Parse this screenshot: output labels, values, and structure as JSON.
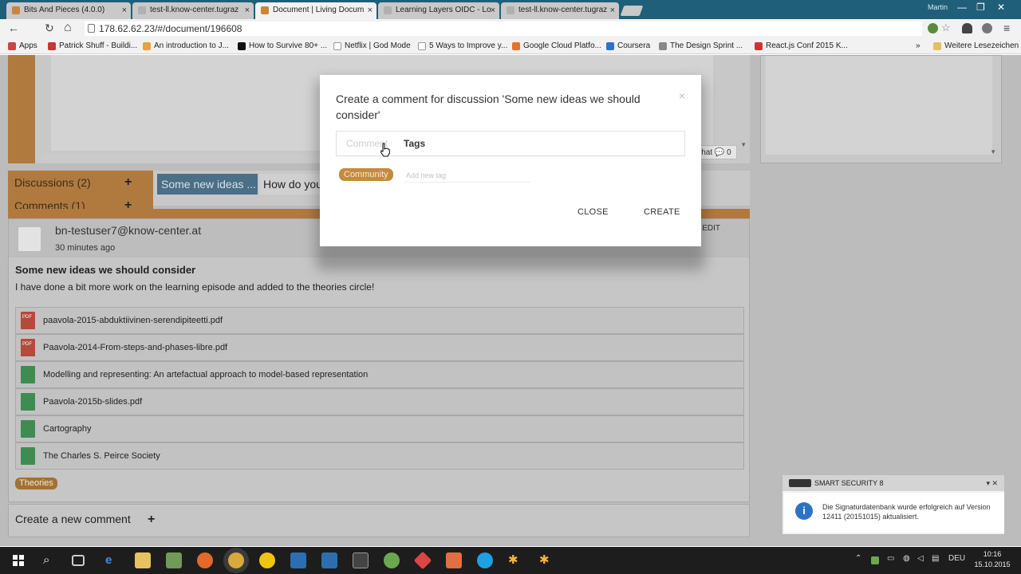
{
  "browser": {
    "tabs": [
      {
        "title": "Bits And Pieces (4.0.0)",
        "active": false
      },
      {
        "title": "test-ll.know-center.tugraz",
        "active": false
      },
      {
        "title": "Document | Living Docum",
        "active": true
      },
      {
        "title": "Learning Layers OIDC - Lo",
        "active": false
      },
      {
        "title": "test-ll.know-center.tugraz",
        "active": false
      }
    ],
    "tab_close": "×",
    "user": "Martin",
    "window_controls": [
      "—",
      "❐",
      "✕"
    ],
    "nav": {
      "back": "←",
      "reload": "↻",
      "home": "⌂"
    },
    "url": "178.62.62.23/#/document/196608",
    "bookmarks": [
      {
        "label": "Apps",
        "color": "#d44"
      },
      {
        "label": "Patrick Shuff - Buildi...",
        "color": "#c33"
      },
      {
        "label": "An introduction to J...",
        "color": "#e8a23a"
      },
      {
        "label": "How to Survive 80+ ...",
        "color": "#111"
      },
      {
        "label": "Netflix | God Mode",
        "color": "#ccc"
      },
      {
        "label": "5 Ways to Improve y...",
        "color": "#ccc"
      },
      {
        "label": "Google Cloud Platfo...",
        "color": "#e8702a"
      },
      {
        "label": "Coursera",
        "color": "#2a73cc"
      },
      {
        "label": "The Design Sprint ...",
        "color": "#888"
      },
      {
        "label": "React.js Conf 2015 K...",
        "color": "#c33"
      }
    ],
    "bookmarks_more": "»",
    "other_bookmarks": "Weitere Lesezeichen"
  },
  "page": {
    "chat_button": "hat 💬 0",
    "sidebar": [
      {
        "label": "Discussions (2)",
        "plus": "+"
      },
      {
        "label": "Comments (1)",
        "plus": "+"
      }
    ],
    "discussion_tabs": [
      {
        "label": "Some new ideas ...",
        "active": true
      },
      {
        "label": "How do you",
        "active": false
      }
    ],
    "post": {
      "author": "bn-testuser7@know-center.at",
      "time": "30 minutes ago",
      "edit": "EDIT",
      "title": "Some new ideas we should consider",
      "body": "I have done a bit more work on the learning episode and added to the theories circle!",
      "attachments": [
        {
          "name": "paavola-2015-abduktiivinen-serendipiteetti.pdf",
          "type": "pdf"
        },
        {
          "name": "Paavola-2014-From-steps-and-phases-libre.pdf",
          "type": "pdf"
        },
        {
          "name": "Modelling and representing: An artefactual approach to model-based representation",
          "type": "doc"
        },
        {
          "name": "Paavola-2015b-slides.pdf",
          "type": "doc"
        },
        {
          "name": "Cartography",
          "type": "doc"
        },
        {
          "name": "The Charles S. Peirce Society",
          "type": "doc"
        }
      ],
      "pdf_label": "PDF",
      "tag": "Theories"
    },
    "new_comment": {
      "label": "Create a new comment",
      "plus": "+"
    }
  },
  "modal": {
    "title": "Create a comment for discussion 'Some new ideas we should consider'",
    "close_x": "×",
    "tabs": [
      "Comment",
      "Tags"
    ],
    "tag": "Community",
    "tag_placeholder": "Add new tag",
    "close_button": "CLOSE",
    "create_button": "CREATE"
  },
  "notification": {
    "app": "SMART SECURITY 8",
    "controls": "▾ ✕",
    "info": "i",
    "message": "Die Signaturdatenbank wurde erfolgreich auf Version 12411 (20151015) aktualisiert."
  },
  "taskbar": {
    "search": "⌕",
    "lang": "DEU",
    "time": "10:16",
    "date": "15.10.2015"
  }
}
